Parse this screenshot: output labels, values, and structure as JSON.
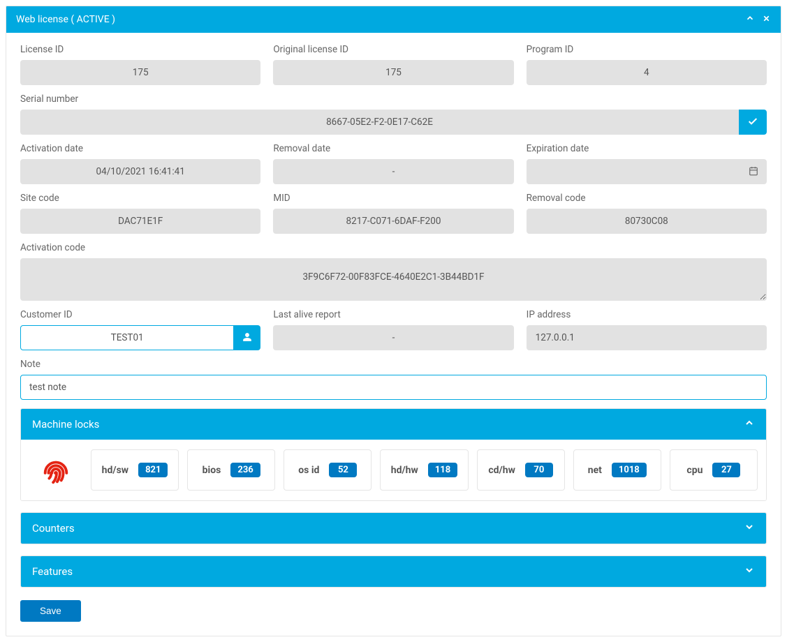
{
  "header": {
    "title": "Web license ( ACTIVE )"
  },
  "fields": {
    "license_id": {
      "label": "License ID",
      "value": "175"
    },
    "original_license_id": {
      "label": "Original license ID",
      "value": "175"
    },
    "program_id": {
      "label": "Program ID",
      "value": "4"
    },
    "serial_number": {
      "label": "Serial number",
      "value": "8667-05E2-F2-0E17-C62E"
    },
    "activation_date": {
      "label": "Activation date",
      "value": "04/10/2021 16:41:41"
    },
    "removal_date": {
      "label": "Removal date",
      "value": "-"
    },
    "expiration_date": {
      "label": "Expiration date",
      "value": ""
    },
    "site_code": {
      "label": "Site code",
      "value": "DAC71E1F"
    },
    "mid": {
      "label": "MID",
      "value": "8217-C071-6DAF-F200"
    },
    "removal_code": {
      "label": "Removal code",
      "value": "80730C08"
    },
    "activation_code": {
      "label": "Activation code",
      "value": "3F9C6F72-00F83FCE-4640E2C1-3B44BD1F"
    },
    "customer_id": {
      "label": "Customer ID",
      "value": "TEST01"
    },
    "last_alive": {
      "label": "Last alive report",
      "value": "-"
    },
    "ip_address": {
      "label": "IP address",
      "value": "127.0.0.1"
    },
    "note": {
      "label": "Note",
      "value": "test note"
    }
  },
  "machine_locks": {
    "title": "Machine locks",
    "items": [
      {
        "label": "hd/sw",
        "value": "821"
      },
      {
        "label": "bios",
        "value": "236"
      },
      {
        "label": "os id",
        "value": "52"
      },
      {
        "label": "hd/hw",
        "value": "118"
      },
      {
        "label": "cd/hw",
        "value": "70"
      },
      {
        "label": "net",
        "value": "1018"
      },
      {
        "label": "cpu",
        "value": "27"
      }
    ]
  },
  "counters": {
    "title": "Counters"
  },
  "features": {
    "title": "Features"
  },
  "buttons": {
    "save": "Save"
  },
  "colors": {
    "primary": "#00a9e0",
    "badge": "#0079c2",
    "fingerprint": "#e42313"
  }
}
